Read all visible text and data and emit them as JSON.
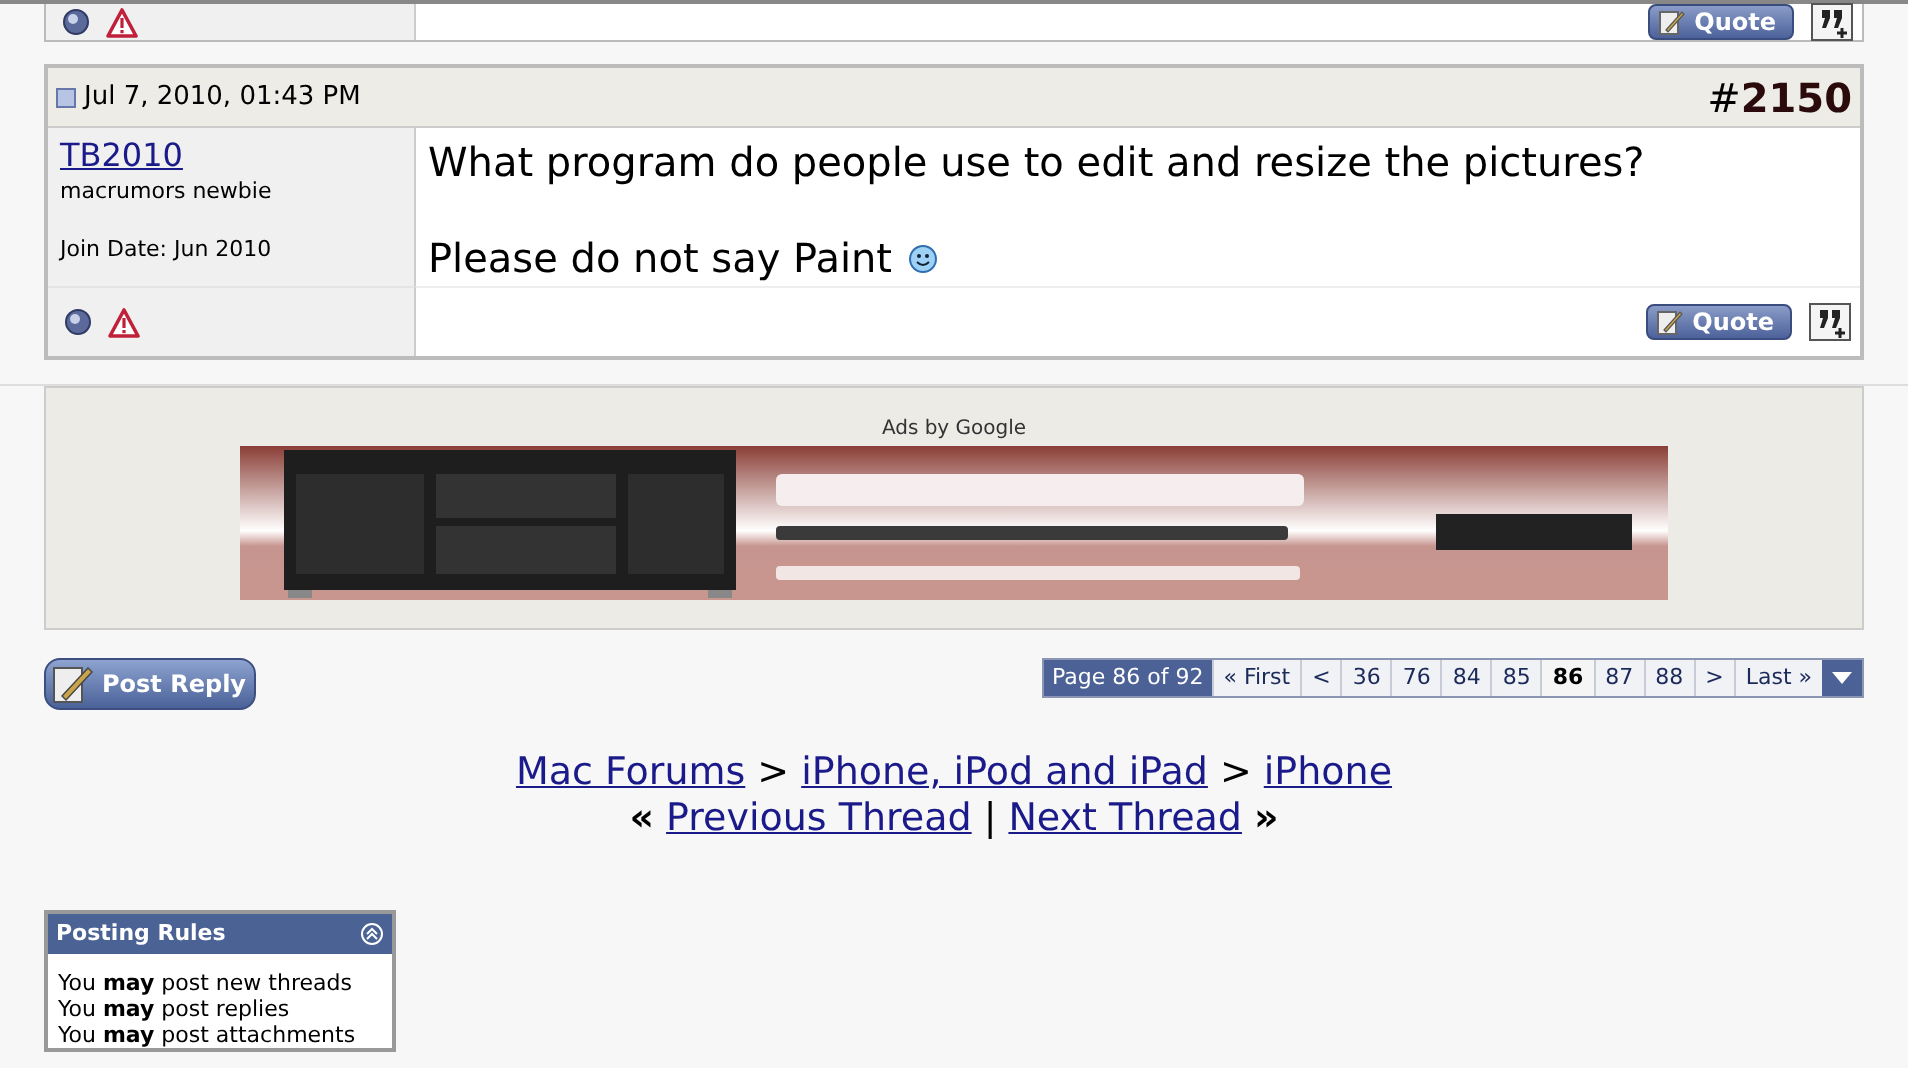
{
  "previous_post": {
    "quote_button": "Quote"
  },
  "post": {
    "date": "Jul 7, 2010, 01:43 PM",
    "number_prefix": "#",
    "number": "2150",
    "username": "TB2010",
    "user_title": "macrumors newbie",
    "join_date": "Join Date: Jun 2010",
    "message": [
      "What program do people use to edit and resize the pictures?",
      "Please do not say Paint"
    ],
    "quote_button": "Quote"
  },
  "ad": {
    "label": "Ads by Google"
  },
  "post_reply_button": "Post Reply",
  "pagination": {
    "label": "Page 86 of 92",
    "pages": [
      {
        "text": "« First",
        "selected": false
      },
      {
        "text": "<",
        "selected": false
      },
      {
        "text": "36",
        "selected": false
      },
      {
        "text": "76",
        "selected": false
      },
      {
        "text": "84",
        "selected": false
      },
      {
        "text": "85",
        "selected": false
      },
      {
        "text": "86",
        "selected": true
      },
      {
        "text": "87",
        "selected": false
      },
      {
        "text": "88",
        "selected": false
      },
      {
        "text": ">",
        "selected": false
      },
      {
        "text": "Last »",
        "selected": false
      }
    ]
  },
  "breadcrumb": [
    {
      "text": "Mac Forums"
    },
    {
      "text": "iPhone, iPod and iPad"
    },
    {
      "text": "iPhone"
    }
  ],
  "breadcrumb_separator": ">",
  "thread_nav": {
    "prev_mark": "«",
    "previous": "Previous Thread",
    "divider": "|",
    "next": "Next Thread",
    "next_mark": "»"
  },
  "posting_rules": {
    "title": "Posting Rules",
    "rules": [
      "You **may** post new threads",
      "You **may** post replies",
      "You **may** post attachments"
    ]
  }
}
